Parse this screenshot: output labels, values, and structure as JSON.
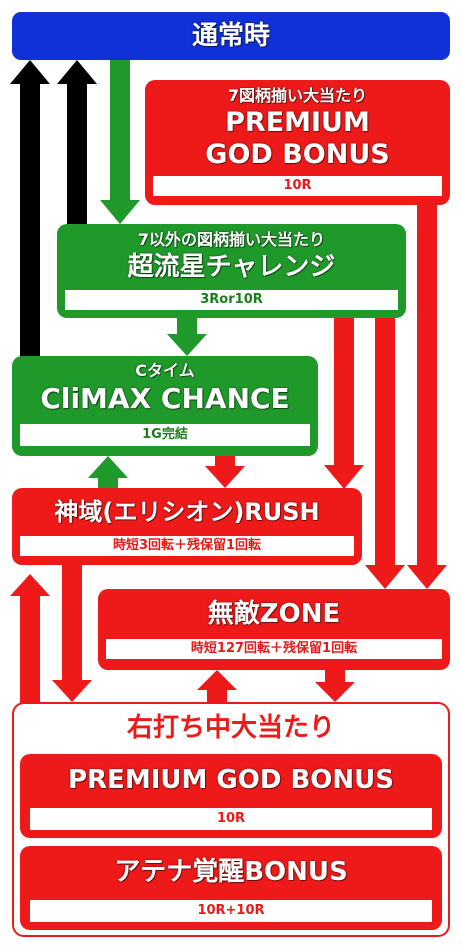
{
  "normal": {
    "title": "通常時"
  },
  "premium": {
    "caption": "7図柄揃い大当たり",
    "title1": "PREMIUM",
    "title2": "GOD BONUS",
    "rounds": "10R"
  },
  "chou": {
    "caption": "7以外の図柄揃い大当たり",
    "title": "超流星チャレンジ",
    "rounds": "3Ror10R"
  },
  "ctime": {
    "caption": "Cタイム",
    "title": "CliMAX CHANCE",
    "detail": "1G完結"
  },
  "rush": {
    "title": "神域(エリシオン)RUSH",
    "detail": "時短3回転＋残保留1回転"
  },
  "zone": {
    "title": "無敵ZONE",
    "detail": "時短127回転＋残保留1回転"
  },
  "right": {
    "title": "右打ち中大当たり",
    "pgb": {
      "title": "PREMIUM GOD BONUS",
      "rounds": "10R"
    },
    "athena": {
      "title": "アテナ覚醒BONUS",
      "rounds": "10R+10R"
    }
  },
  "colors": {
    "blue": "#1030d8",
    "red": "#ee1a1a",
    "green": "#1f9a2a",
    "black": "#000000"
  }
}
